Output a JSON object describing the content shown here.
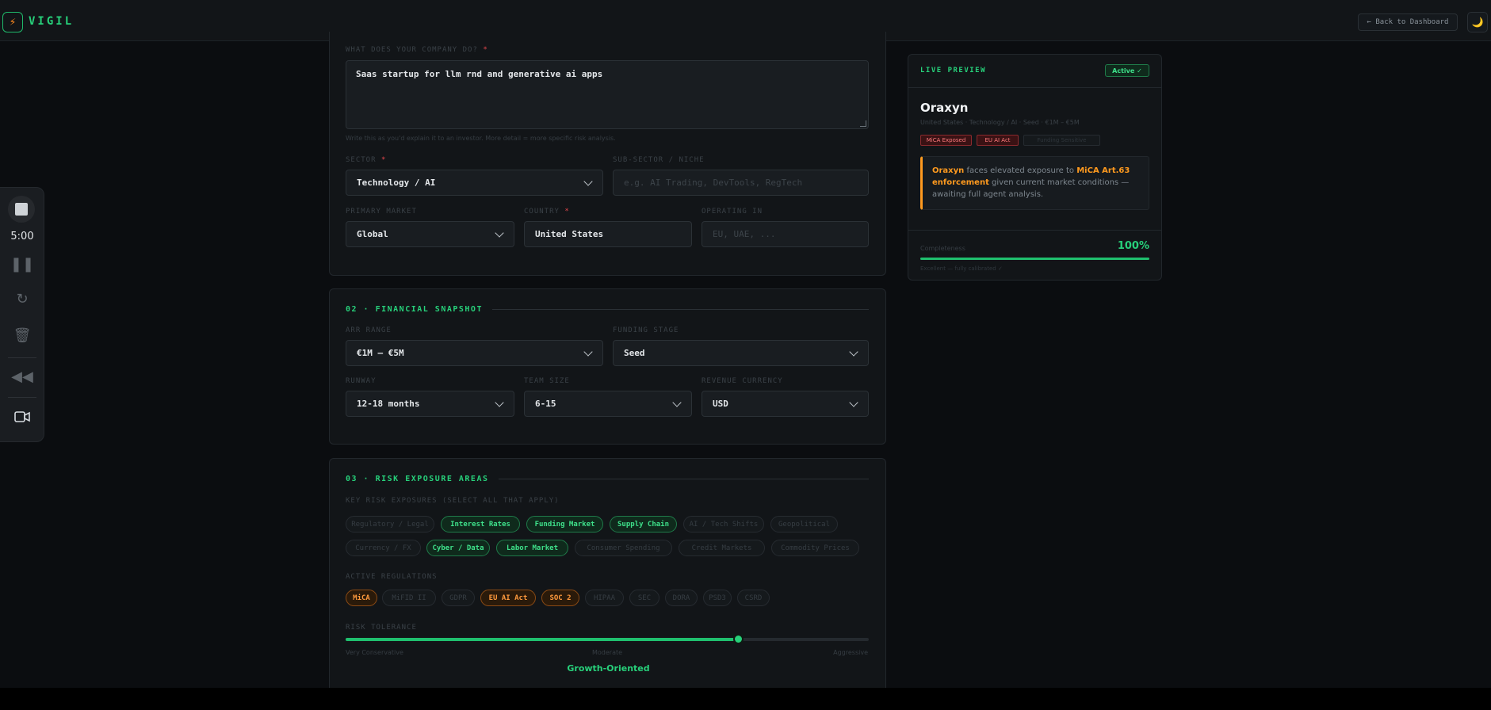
{
  "header": {
    "logo_glyph": "⚡",
    "app_name": "VIGIL",
    "back_label": "← Back to Dashboard",
    "theme_glyph": "🌙"
  },
  "recorder": {
    "time": "5:00"
  },
  "section1": {
    "company_label": "WHAT DOES YOUR COMPANY DO?",
    "company_value": "Saas startup for llm rnd and generative ai apps",
    "company_hint": "Write this as you'd explain it to an investor. More detail = more specific risk analysis.",
    "sector_label": "SECTOR",
    "sector_value": "Technology / AI",
    "subsector_label": "SUB-SECTOR / NICHE",
    "subsector_placeholder": "e.g. AI Trading, DevTools, RegTech",
    "market_label": "PRIMARY MARKET",
    "market_value": "Global",
    "country_label": "COUNTRY",
    "country_value": "United States",
    "operating_label": "OPERATING IN",
    "operating_placeholder": "EU, UAE, ..."
  },
  "section2": {
    "title": "02 · FINANCIAL SNAPSHOT",
    "arr_label": "ARR RANGE",
    "arr_value": "€1M – €5M",
    "funding_label": "FUNDING STAGE",
    "funding_value": "Seed",
    "runway_label": "RUNWAY",
    "runway_value": "12-18 months",
    "team_label": "TEAM SIZE",
    "team_value": "6-15",
    "currency_label": "REVENUE CURRENCY",
    "currency_value": "USD"
  },
  "section3": {
    "title": "03 · RISK EXPOSURE AREAS",
    "risk_label": "KEY RISK EXPOSURES (SELECT ALL THAT APPLY)",
    "risks": [
      {
        "label": "Regulatory / Legal",
        "state": "off"
      },
      {
        "label": "Interest Rates",
        "state": "on"
      },
      {
        "label": "Funding Market",
        "state": "on"
      },
      {
        "label": "Supply Chain",
        "state": "on"
      },
      {
        "label": "AI / Tech Shifts",
        "state": "off"
      },
      {
        "label": "Geopolitical",
        "state": "off"
      },
      {
        "label": "Currency / FX",
        "state": "off"
      },
      {
        "label": "Cyber / Data",
        "state": "on"
      },
      {
        "label": "Labor Market",
        "state": "on"
      },
      {
        "label": "Consumer Spending",
        "state": "off"
      },
      {
        "label": "Credit Markets",
        "state": "off"
      },
      {
        "label": "Commodity Prices",
        "state": "off"
      }
    ],
    "reg_label": "ACTIVE REGULATIONS",
    "regulations": [
      {
        "label": "MiCA",
        "state": "on"
      },
      {
        "label": "MiFID II",
        "state": "off"
      },
      {
        "label": "GDPR",
        "state": "off"
      },
      {
        "label": "EU AI Act",
        "state": "on"
      },
      {
        "label": "SOC 2",
        "state": "on"
      },
      {
        "label": "HIPAA",
        "state": "off"
      },
      {
        "label": "SEC",
        "state": "off"
      },
      {
        "label": "DORA",
        "state": "off"
      },
      {
        "label": "PSD3",
        "state": "off"
      },
      {
        "label": "CSRD",
        "state": "off"
      }
    ],
    "tolerance_label": "RISK TOLERANCE",
    "tolerance_fraction": 0.75,
    "tick_low": "Very Conservative",
    "tick_mid": "Moderate",
    "tick_high": "Aggressive",
    "tolerance_value": "Growth-Oriented"
  },
  "preview": {
    "title": "LIVE PREVIEW",
    "badge": "Active ✓",
    "company": "Oraxyn",
    "meta": "United States · Technology / AI · Seed · €1M – €5M",
    "tags": [
      {
        "label": "MiCA Exposed",
        "style": "red"
      },
      {
        "label": "EU AI Act",
        "style": "red"
      },
      {
        "label": "Funding Sensitive",
        "style": "dim"
      }
    ],
    "alert_company": "Oraxyn",
    "alert_mid": " faces elevated exposure to ",
    "alert_reg": "MiCA Art.63 enforcement",
    "alert_tail": " given current market conditions — awaiting full agent analysis.",
    "completeness_label": "Completeness",
    "completeness_value": "100%",
    "completeness_fraction": 1.0,
    "footer": "Excellent — fully calibrated ✓"
  },
  "colors": {
    "accent": "#27d07a",
    "warning": "#ff9a1f",
    "danger": "#e5484d",
    "background": "#0b0d10"
  }
}
